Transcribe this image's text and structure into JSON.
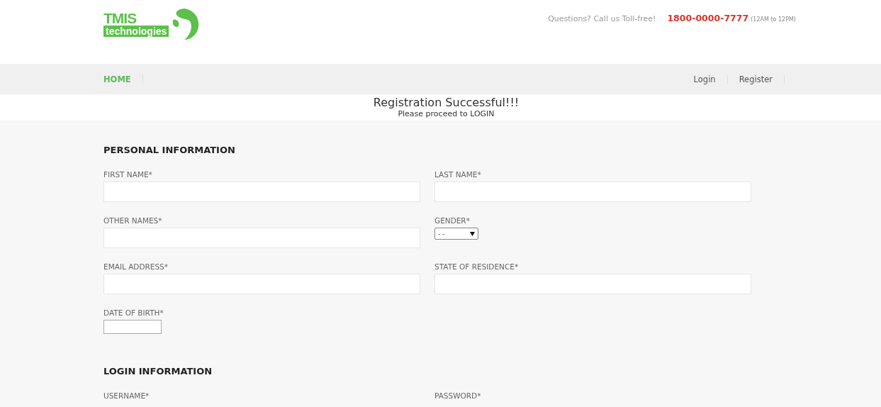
{
  "logo": {
    "title": "TMIS",
    "subtitle": "technologies"
  },
  "contact": {
    "prompt": "Questions? Call us Toll-free!",
    "phone": "1800-0000-7777",
    "hours": "(12AM to 12PM)"
  },
  "nav": {
    "left": [
      {
        "label": "HOME",
        "selected": true
      }
    ],
    "right": [
      {
        "label": "Login",
        "selected": false
      },
      {
        "label": "Register",
        "selected": false
      }
    ]
  },
  "message": {
    "title": "Registration Successful!!!",
    "subtitle": "Please proceed to LOGIN"
  },
  "sections": [
    {
      "heading": "PERSONAL INFORMATION",
      "fields": [
        {
          "label": "FIRST NAME*",
          "kind": "text"
        },
        {
          "label": "LAST NAME*",
          "kind": "text"
        },
        {
          "label": "OTHER NAMES*",
          "kind": "text"
        },
        {
          "label": "GENDER*",
          "kind": "select",
          "value": "- -"
        },
        {
          "label": "EMAIL ADDRESS*",
          "kind": "text"
        },
        {
          "label": "STATE OF RESIDENCE*",
          "kind": "text"
        },
        {
          "label": "DATE OF BIRTH*",
          "kind": "short"
        }
      ]
    },
    {
      "heading": "LOGIN INFORMATION",
      "fields": [
        {
          "label": "USERNAME*",
          "kind": "label"
        },
        {
          "label": "PASSWORD*",
          "kind": "label"
        }
      ]
    }
  ]
}
